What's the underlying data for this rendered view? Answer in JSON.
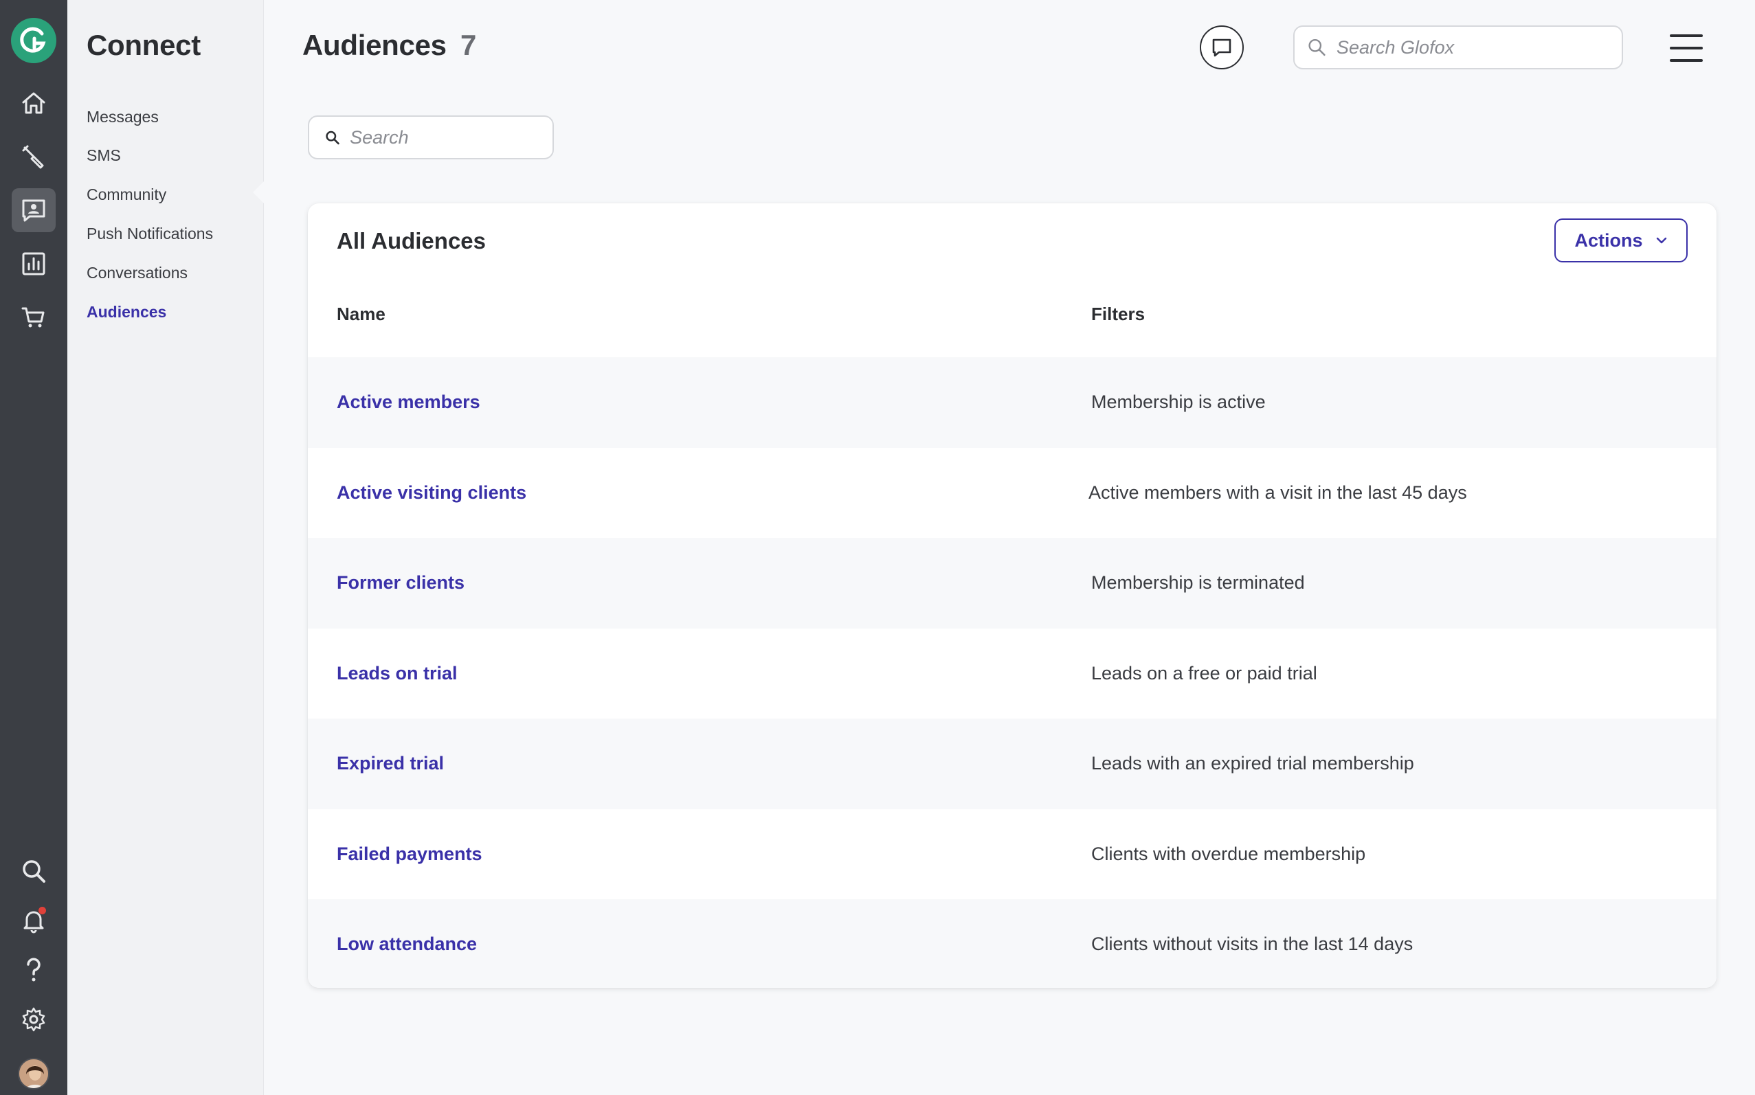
{
  "rail": {
    "items": [
      {
        "icon": "home-icon"
      },
      {
        "icon": "wrench-icon"
      },
      {
        "icon": "connect-icon",
        "active": true
      },
      {
        "icon": "bar-chart-icon"
      },
      {
        "icon": "cart-icon"
      }
    ],
    "bottom": [
      {
        "icon": "search-icon"
      },
      {
        "icon": "bell-icon",
        "has_notification": true
      },
      {
        "icon": "help-icon"
      },
      {
        "icon": "gear-icon"
      }
    ]
  },
  "sidebar": {
    "title": "Connect",
    "items": [
      {
        "label": "Messages"
      },
      {
        "label": "SMS"
      },
      {
        "label": "Community"
      },
      {
        "label": "Push Notifications"
      },
      {
        "label": "Conversations"
      },
      {
        "label": "Audiences",
        "active": true
      }
    ]
  },
  "header": {
    "title": "Audiences",
    "count": "7",
    "global_search_placeholder": "Search Glofox"
  },
  "list_search": {
    "placeholder": "Search"
  },
  "card": {
    "title": "All Audiences",
    "actions_label": "Actions",
    "columns": {
      "name": "Name",
      "filters": "Filters"
    },
    "rows": [
      {
        "name": "Active members",
        "filter": "Membership is active"
      },
      {
        "name": "Active visiting clients",
        "filter": "Active members with a visit in the last 45 days"
      },
      {
        "name": "Former clients",
        "filter": "Membership is terminated"
      },
      {
        "name": "Leads on trial",
        "filter": "Leads on a free or paid trial"
      },
      {
        "name": "Expired trial",
        "filter": "Leads with an expired trial membership"
      },
      {
        "name": "Failed payments",
        "filter": "Clients with overdue membership"
      },
      {
        "name": "Low attendance",
        "filter": "Clients without visits in the last 14 days"
      }
    ]
  },
  "colors": {
    "accent": "#3a31a8",
    "rail_bg": "#3b3e44",
    "logo": "#2aa27a",
    "notification": "#e0413a"
  }
}
